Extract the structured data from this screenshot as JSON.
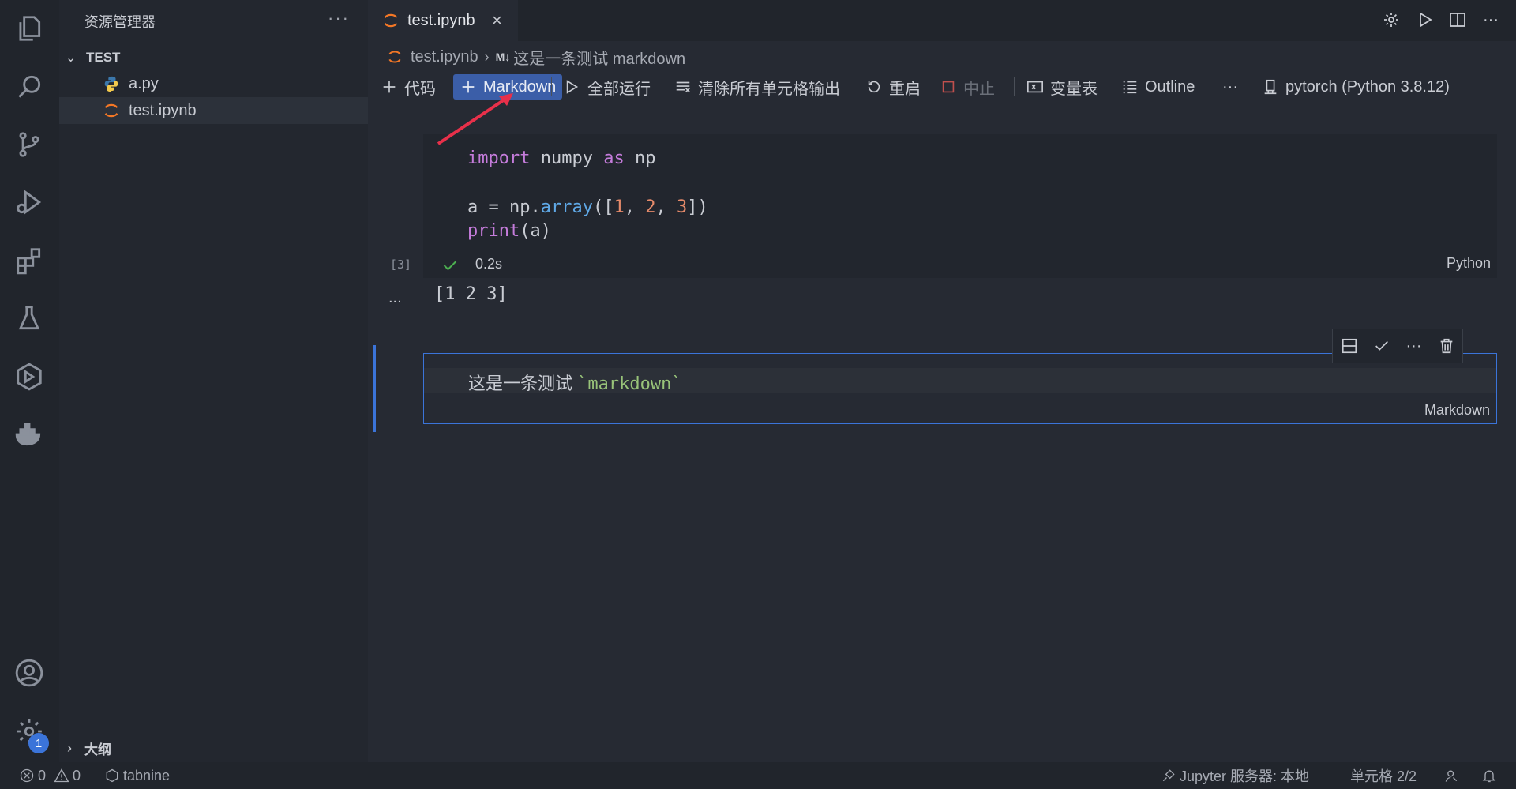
{
  "sidebar": {
    "title": "资源管理器",
    "more": "···",
    "folder": "TEST",
    "files": [
      {
        "name": "a.py",
        "icon": "python-file-icon"
      },
      {
        "name": "test.ipynb",
        "icon": "jupyter-file-icon"
      }
    ],
    "outline": "大纲"
  },
  "activity": {
    "badge": "1"
  },
  "tab": {
    "label": "test.ipynb",
    "close": "×"
  },
  "breadcrumb": {
    "file": "test.ipynb",
    "md_icon": "M↓",
    "section": "这是一条测试 markdown"
  },
  "toolbar": {
    "code": "代码",
    "markdown": "Markdown",
    "run_all": "全部运行",
    "clear_outputs": "清除所有单元格输出",
    "restart": "重启",
    "interrupt": "中止",
    "variables": "变量表",
    "outline": "Outline",
    "more": "···",
    "kernel": "pytorch (Python 3.8.12)"
  },
  "cell1": {
    "exec_count": "[3]",
    "duration": "0.2s",
    "language": "Python",
    "output_prefix": "...",
    "output": "[1 2 3]"
  },
  "cell2": {
    "text_plain": "这是一条测试 ",
    "text_code": "`markdown`",
    "language": "Markdown"
  },
  "cell_toolbar": {
    "more": "···"
  },
  "statusbar": {
    "errors": "0",
    "warnings": "0",
    "tabnine": "tabnine",
    "jupyter": "Jupyter 服务器: 本地",
    "cell_position": "单元格 2/2"
  },
  "colors": {
    "accent": "#3b74d9",
    "primary_button": "#3b5ea8",
    "annotation_arrow": "#e8304a"
  }
}
